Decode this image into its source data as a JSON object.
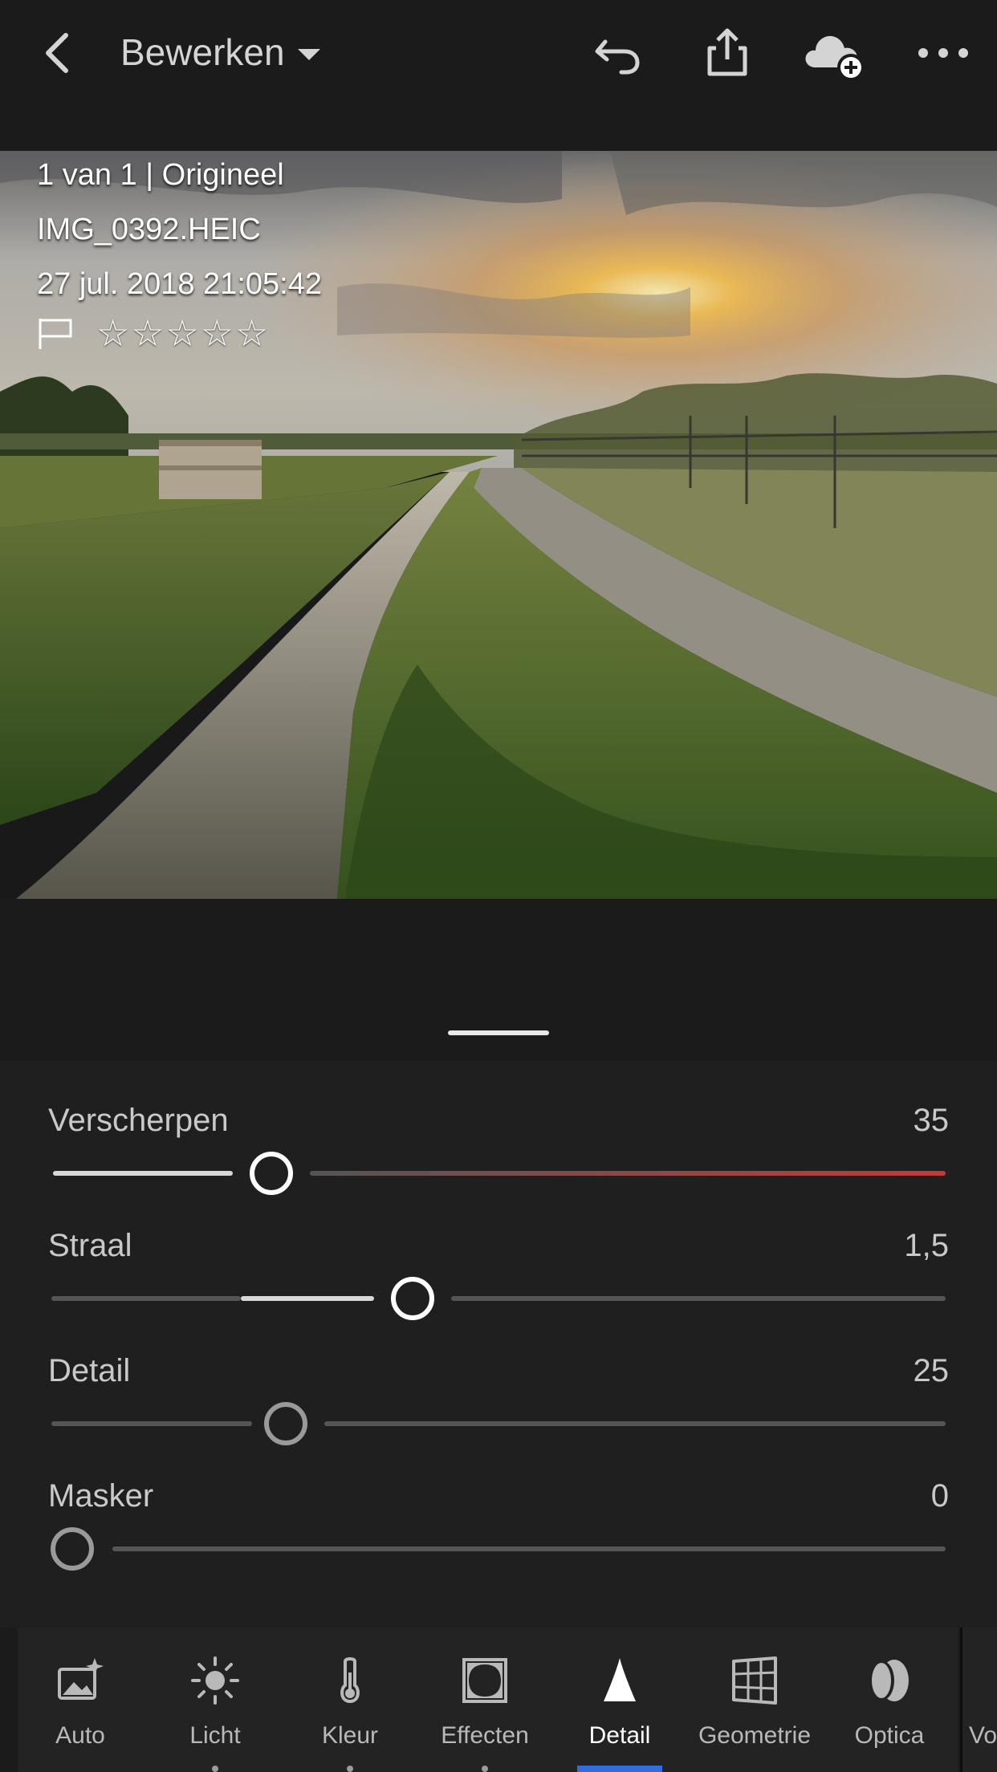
{
  "header": {
    "title": "Bewerken",
    "icons": [
      "back-chevron-icon",
      "undo-icon",
      "share-icon",
      "cloud-add-icon",
      "more-icon"
    ]
  },
  "photo": {
    "counter": "1 van 1 | Origineel",
    "filename": "IMG_0392.HEIC",
    "datetime": "27 jul. 2018 21:05:42",
    "stars": "☆☆☆☆☆",
    "rating": 0
  },
  "sliders": [
    {
      "label": "Verscherpen",
      "value": "35",
      "position": 0.25
    },
    {
      "label": "Straal",
      "value": "1,5",
      "position": 0.41
    },
    {
      "label": "Detail",
      "value": "25",
      "position": 0.265
    },
    {
      "label": "Masker",
      "value": "0",
      "position": 0.0
    }
  ],
  "tools": [
    {
      "label": "Auto",
      "icon": "auto-icon"
    },
    {
      "label": "Licht",
      "icon": "sun-icon"
    },
    {
      "label": "Kleur",
      "icon": "thermometer-icon"
    },
    {
      "label": "Effecten",
      "icon": "vignette-icon"
    },
    {
      "label": "Detail",
      "icon": "detail-triangle-icon",
      "active": true
    },
    {
      "label": "Geometrie",
      "icon": "geometry-grid-icon"
    },
    {
      "label": "Optica",
      "icon": "lens-icon"
    },
    {
      "label": "Vo",
      "icon": ""
    }
  ],
  "colors": {
    "accent": "#2f6de0",
    "background": "#1b1b1b",
    "panel": "#1f1f1f",
    "sharpen_track_end": "#c23a3a"
  }
}
